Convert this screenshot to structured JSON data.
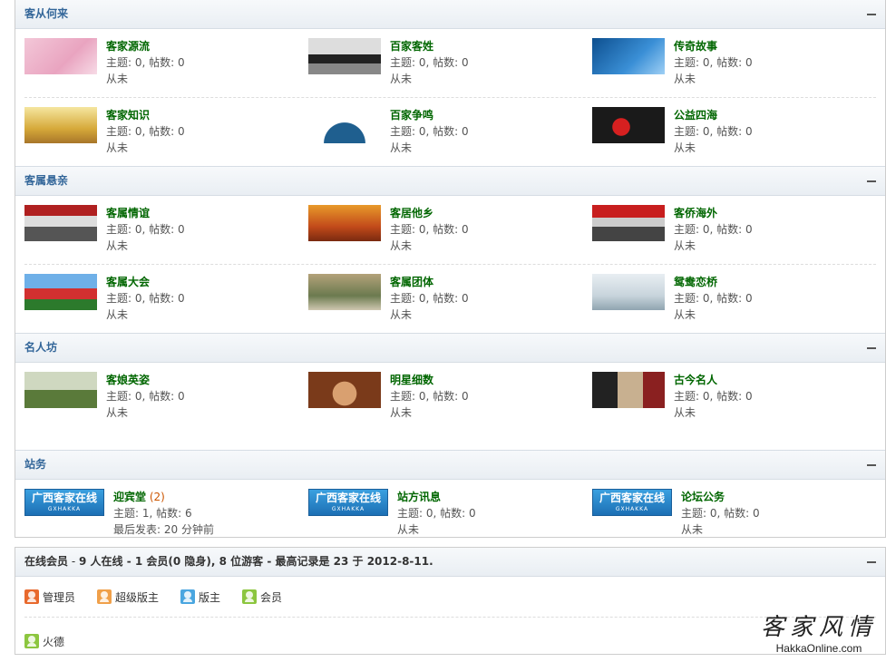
{
  "categories": [
    {
      "title": "客从何来",
      "forums": [
        {
          "name": "客家源流",
          "stats": "主题: 0, 帖数: 0",
          "last": "从未",
          "thumb": "pink-title"
        },
        {
          "name": "百家客姓",
          "stats": "主题: 0, 帖数: 0",
          "last": "从未",
          "thumb": "silhouettes"
        },
        {
          "name": "传奇故事",
          "stats": "主题: 0, 帖数: 0",
          "last": "从未",
          "thumb": "blue-boat"
        },
        {
          "name": "客家知识",
          "stats": "主题: 0, 帖数: 0",
          "last": "从未",
          "thumb": "auditorium"
        },
        {
          "name": "百家争鸣",
          "stats": "主题: 0, 帖数: 0",
          "last": "从未",
          "thumb": "landscape"
        },
        {
          "name": "公益四海",
          "stats": "主题: 0, 帖数: 0",
          "last": "从未",
          "thumb": "heart"
        }
      ]
    },
    {
      "title": "客属悬亲",
      "forums": [
        {
          "name": "客属情谊",
          "stats": "主题: 0, 帖数: 0",
          "last": "从未",
          "thumb": "stage"
        },
        {
          "name": "客居他乡",
          "stats": "主题: 0, 帖数: 0",
          "last": "从未",
          "thumb": "hall"
        },
        {
          "name": "客侨海外",
          "stats": "主题: 0, 帖数: 0",
          "last": "从未",
          "thumb": "group"
        },
        {
          "name": "客属大会",
          "stats": "主题: 0, 帖数: 0",
          "last": "从未",
          "thumb": "arch"
        },
        {
          "name": "客属团体",
          "stats": "主题: 0, 帖数: 0",
          "last": "从未",
          "thumb": "team"
        },
        {
          "name": "鸳鸯恋桥",
          "stats": "主题: 0, 帖数: 0",
          "last": "从未",
          "thumb": "ducks"
        }
      ]
    },
    {
      "title": "名人坊",
      "forums": [
        {
          "name": "客娘英姿",
          "stats": "主题: 0, 帖数: 0",
          "last": "从未",
          "thumb": "dancer"
        },
        {
          "name": "明星细数",
          "stats": "主题: 0, 帖数: 0",
          "last": "从未",
          "thumb": "portrait"
        },
        {
          "name": "古今名人",
          "stats": "主题: 0, 帖数: 0",
          "last": "从未",
          "thumb": "exhibit"
        }
      ]
    },
    {
      "title": "站务",
      "forums": [
        {
          "name": "迎宾堂",
          "count": "(2)",
          "stats": "主题: 1, 帖数: 6",
          "last": "最后发表: 20 分钟前",
          "thumb": "logo"
        },
        {
          "name": "站方讯息",
          "stats": "主题: 0, 帖数: 0",
          "last": "从未",
          "thumb": "logo"
        },
        {
          "name": "论坛公务",
          "stats": "主题: 0, 帖数: 0",
          "last": "从未",
          "thumb": "logo"
        }
      ]
    }
  ],
  "logo_text": "广西客家在线",
  "logo_sub": "GXHAKKA",
  "online": {
    "label": "在线会员",
    "summary": "9 人在线 - 1 会员(0 隐身), 8 位游客 - 最高记录是 23 于 2012-8-11.",
    "legend": [
      {
        "label": "管理员",
        "color": "#e8692d"
      },
      {
        "label": "超级版主",
        "color": "#f0a04a"
      },
      {
        "label": "版主",
        "color": "#4aa6e0"
      },
      {
        "label": "会员",
        "color": "#8cc63f"
      }
    ],
    "users": [
      {
        "name": "火德",
        "color": "#8cc63f"
      }
    ]
  },
  "watermark": {
    "cn": "客家风情",
    "en": "HakkaOnline.com"
  }
}
